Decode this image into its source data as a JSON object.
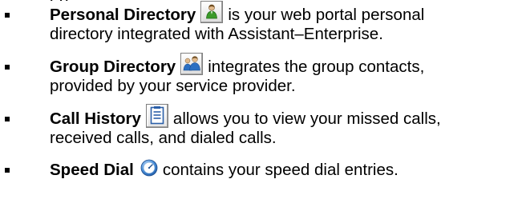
{
  "page": {
    "top_fragment": "ep"
  },
  "items": [
    {
      "title": "Personal Directory",
      "icon": "personal-directory-icon",
      "text_after_icon": "is your web portal personal",
      "line2": "directory integrated with Assistant–Enterprise."
    },
    {
      "title": "Group Directory",
      "icon": "group-directory-icon",
      "text_after_icon": "integrates the group contacts,",
      "line2": "provided by your service provider."
    },
    {
      "title": "Call History",
      "icon": "call-history-icon",
      "text_after_icon": "allows you to view your missed calls,",
      "line2": "received calls, and dialed calls."
    },
    {
      "title": "Speed Dial",
      "icon": "speed-dial-icon",
      "text_after_icon": "contains your speed dial entries.",
      "line2": ""
    }
  ],
  "colors": {
    "text": "#000000",
    "icon_green": "#3a9a2a",
    "icon_blue": "#2b6fc2",
    "icon_border": "#7f7f7f"
  }
}
